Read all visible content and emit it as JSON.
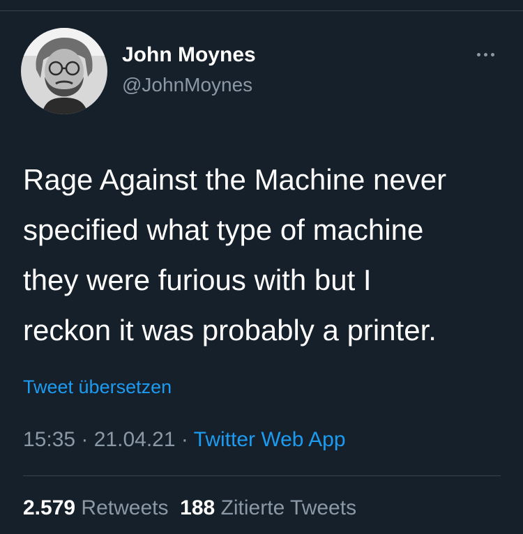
{
  "user": {
    "name": "John Moynes",
    "handle": "@JohnMoynes",
    "avatar_icon": "user-avatar-photo"
  },
  "menu": {
    "icon": "more-horizontal-icon"
  },
  "tweet": {
    "lines": [
      "Rage Against the Machine never",
      "specified what type of machine",
      "they were furious with but I",
      "reckon it was probably a printer."
    ]
  },
  "translate_link": "Tweet übersetzen",
  "meta": {
    "time": "15:35",
    "separator": " · ",
    "date": "21.04.21",
    "source": "Twitter Web App"
  },
  "stats": {
    "retweets_count": "2.579",
    "retweets_label": "Retweets",
    "quotes_count": "188",
    "quotes_label": "Zitierte Tweets"
  },
  "colors": {
    "background": "#15202b",
    "accent": "#1d9bf0",
    "secondary_text": "#8b98a5",
    "divider": "#38444d"
  }
}
